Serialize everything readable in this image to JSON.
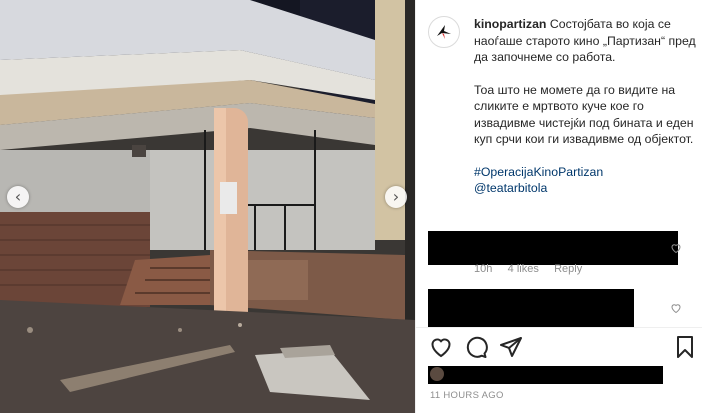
{
  "post": {
    "username": "kinopartizan",
    "caption_line1": "Состојбата во која се наоѓаше старото кино „Партизан“ пред да започнеме со работа.",
    "caption_line2": "Тоа што не мометe да го видите на сликите е мртвото куче кое го извадивме чистејќи под бината и еден куп срчи кои ги извадивме од објектот.",
    "hashtag": "#OperacijaKinoPartizan",
    "mention": "@teatarbitola",
    "caption_time": "11h",
    "timestamp": "11 HOURS AGO"
  },
  "comments": [
    {
      "meta_time": "10h",
      "meta_likes": "4 likes",
      "meta_reply": "Reply"
    },
    {
      "meta_time": "",
      "meta_likes": "",
      "meta_reply": ""
    }
  ],
  "icons": {
    "prev": "chevron-left-icon",
    "next": "chevron-right-icon",
    "like": "heart-icon",
    "comment": "comment-icon",
    "share": "send-icon",
    "save": "bookmark-icon"
  },
  "colors": {
    "text": "#262626",
    "muted": "#8e8e8e",
    "link": "#00376b",
    "border": "#efefef"
  }
}
